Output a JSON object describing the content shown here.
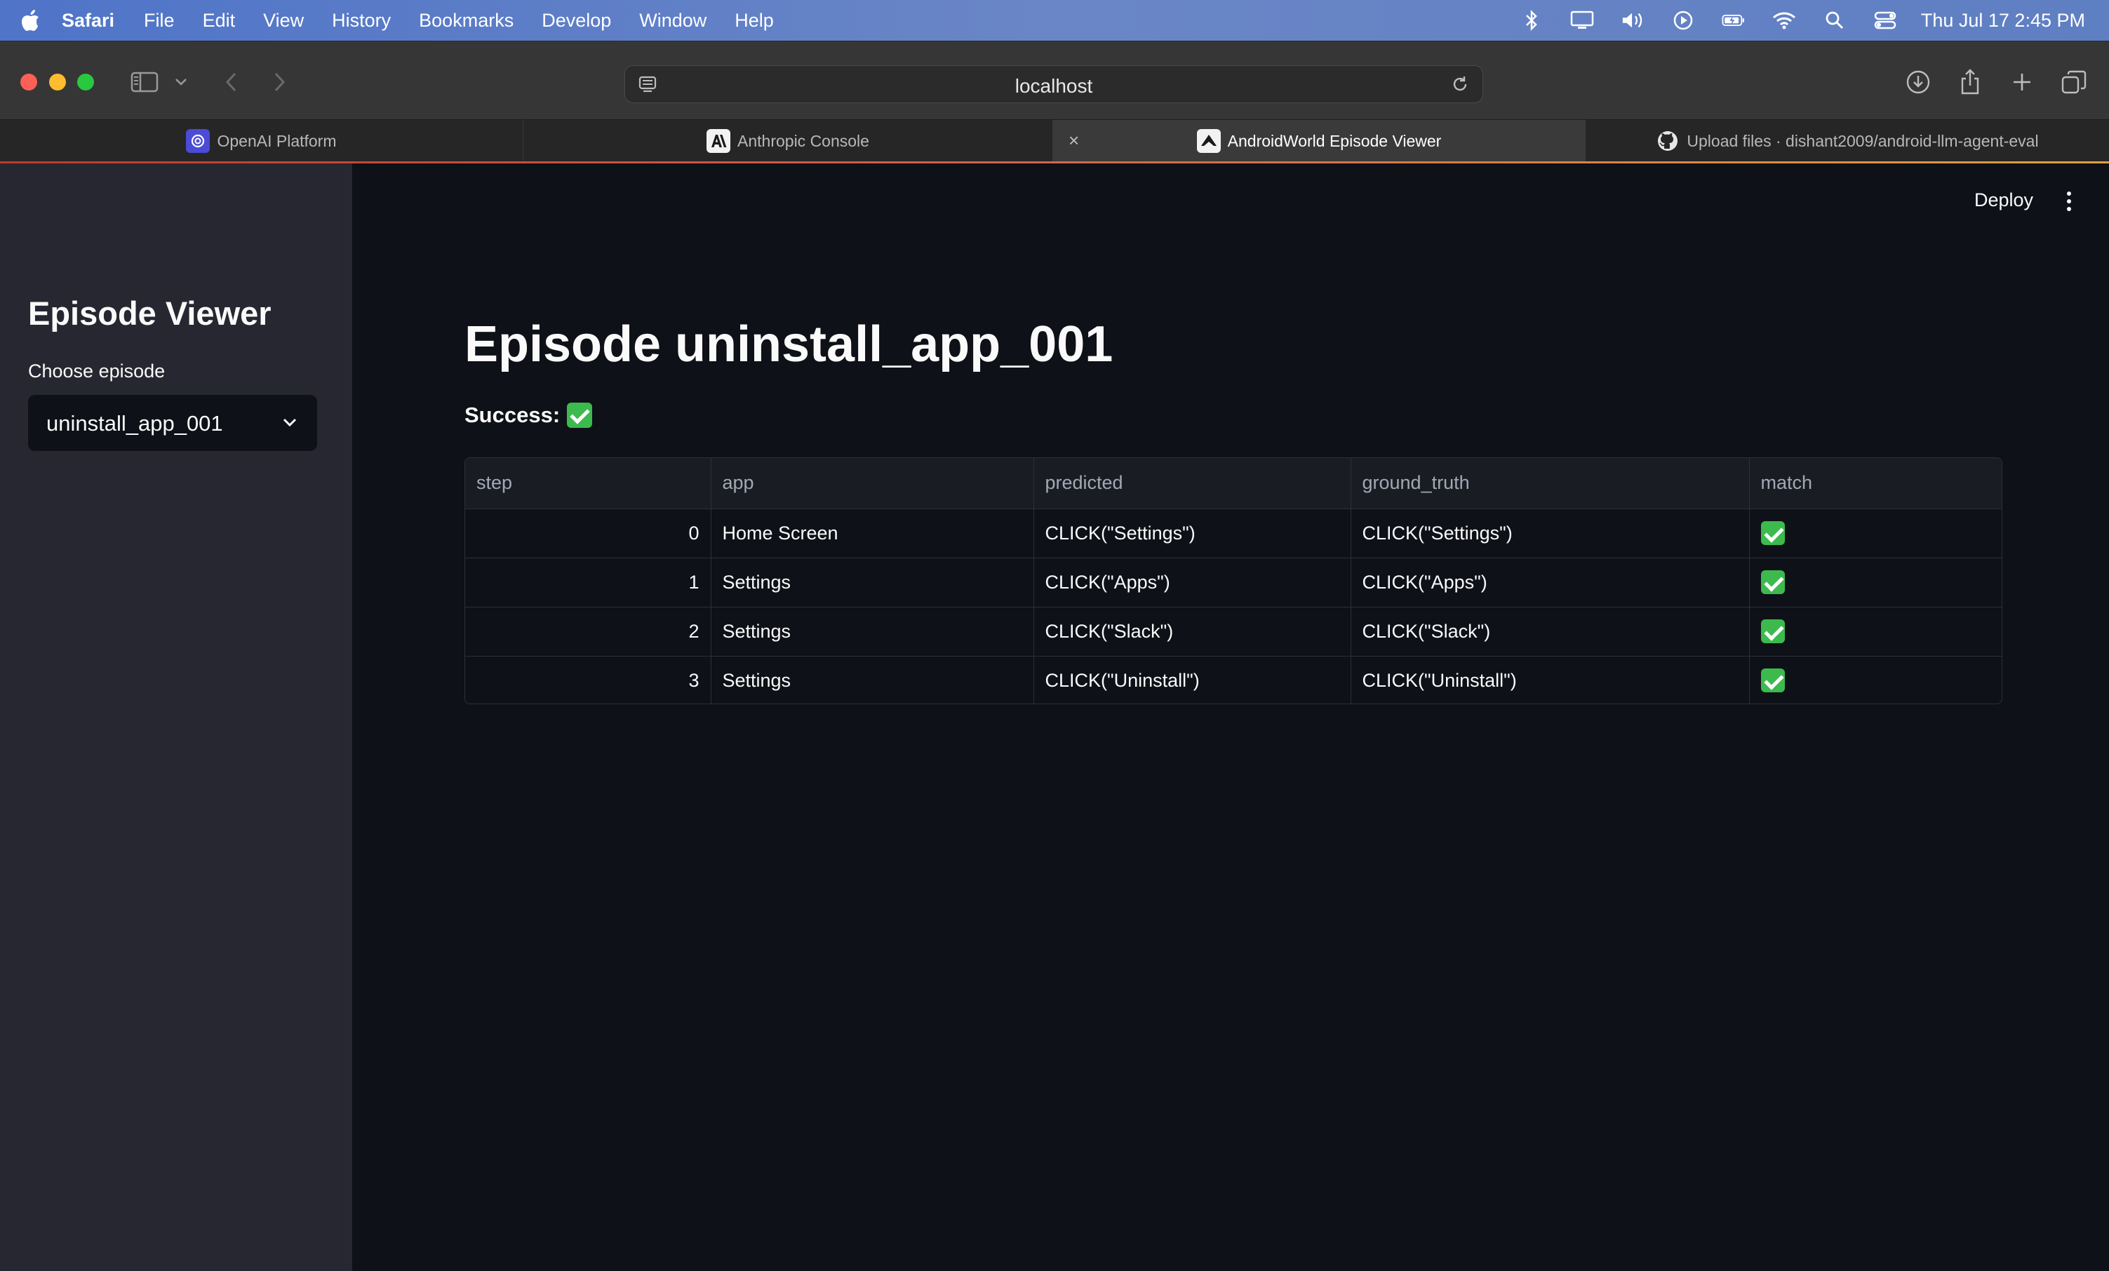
{
  "menubar": {
    "app_name": "Safari",
    "items": [
      "File",
      "Edit",
      "View",
      "History",
      "Bookmarks",
      "Develop",
      "Window",
      "Help"
    ],
    "clock": "Thu Jul 17  2:45 PM",
    "status_icons": [
      "bluetooth-icon",
      "display-icon",
      "volume-icon",
      "play-icon",
      "battery-icon",
      "wifi-icon",
      "search-icon",
      "control-center-icon"
    ]
  },
  "browser": {
    "url": "localhost",
    "tabs": [
      {
        "title": "OpenAI Platform",
        "icon": "openai-icon"
      },
      {
        "title": "Anthropic Console",
        "icon": "anthropic-icon"
      },
      {
        "title": "AndroidWorld Episode Viewer",
        "icon": "streamlit-icon",
        "active": true
      },
      {
        "title": "Upload files · dishant2009/android-llm-agent-eval",
        "icon": "github-icon"
      }
    ]
  },
  "sidebar": {
    "title": "Episode Viewer",
    "select_label": "Choose episode",
    "select_value": "uninstall_app_001"
  },
  "header": {
    "deploy_label": "Deploy"
  },
  "main": {
    "title": "Episode uninstall_app_001",
    "success_label": "Success:",
    "success_value": "✅"
  },
  "table": {
    "columns": [
      "step",
      "app",
      "predicted",
      "ground_truth",
      "match"
    ],
    "rows": [
      {
        "step": "0",
        "app": "Home Screen",
        "predicted": "CLICK(\"Settings\")",
        "ground_truth": "CLICK(\"Settings\")",
        "match": "✅"
      },
      {
        "step": "1",
        "app": "Settings",
        "predicted": "CLICK(\"Apps\")",
        "ground_truth": "CLICK(\"Apps\")",
        "match": "✅"
      },
      {
        "step": "2",
        "app": "Settings",
        "predicted": "CLICK(\"Slack\")",
        "ground_truth": "CLICK(\"Slack\")",
        "match": "✅"
      },
      {
        "step": "3",
        "app": "Settings",
        "predicted": "CLICK(\"Uninstall\")",
        "ground_truth": "CLICK(\"Uninstall\")",
        "match": "✅"
      }
    ]
  },
  "colors": {
    "accent_green": "#3dba4e",
    "bg_main": "#0e1117",
    "bg_sidebar": "#262730"
  }
}
